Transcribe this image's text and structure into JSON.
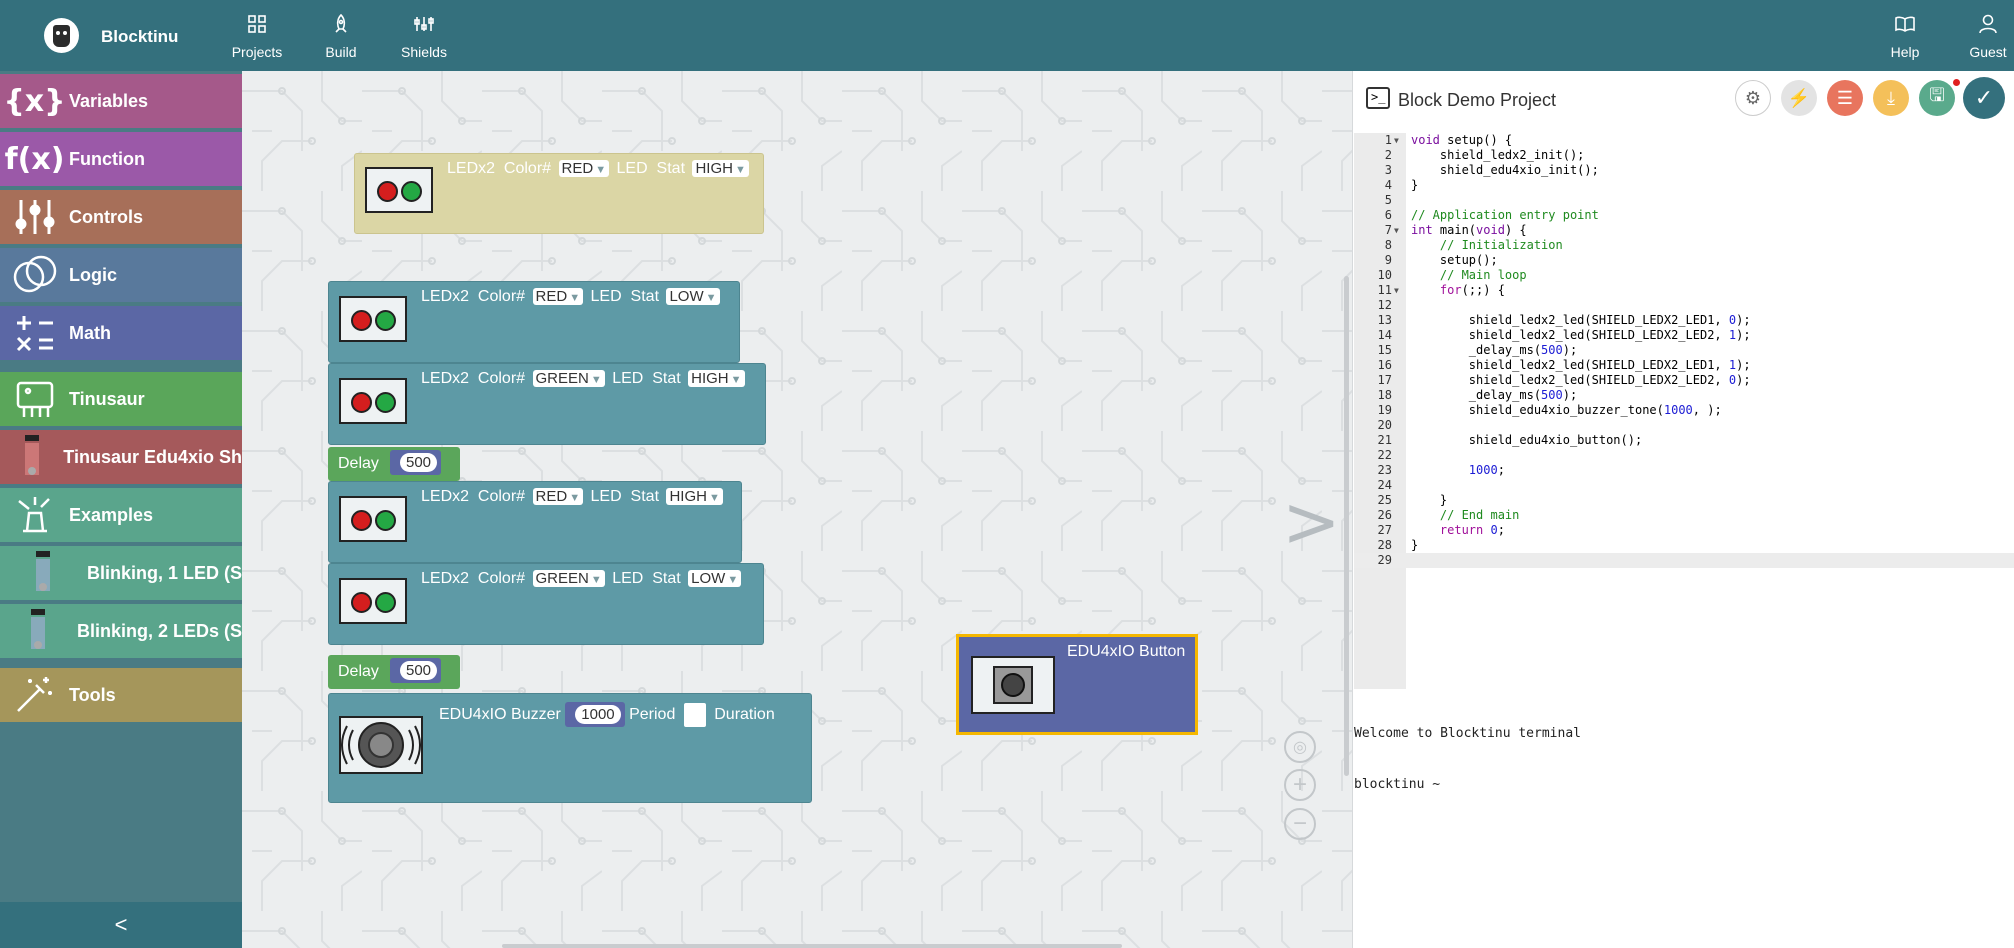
{
  "app": {
    "brand": "Blocktinu"
  },
  "nav": {
    "projects": "Projects",
    "build": "Build",
    "shields": "Shields",
    "help": "Help",
    "guest": "Guest"
  },
  "sidebar": {
    "items": [
      {
        "label": "Variables",
        "color": "#a5598a"
      },
      {
        "label": "Function",
        "color": "#9b59a8"
      },
      {
        "label": "Controls",
        "color": "#a76f59"
      },
      {
        "label": "Logic",
        "color": "#59799c"
      },
      {
        "label": "Math",
        "color": "#5b67a5"
      },
      {
        "label": "Tinusaur",
        "color": "#5aa65a"
      },
      {
        "label": "Tinusaur Edu4xio Sh",
        "color": "#a5595b"
      },
      {
        "label": "Examples",
        "color": "#5aa58c"
      },
      {
        "label": "Blinking, 1 LED (S",
        "color": "#5aa58c"
      },
      {
        "label": "Blinking, 2 LEDs (S",
        "color": "#5aa58c"
      },
      {
        "label": "Tools",
        "color": "#a5965b"
      }
    ],
    "collapse": "<"
  },
  "blocks": {
    "common": {
      "ledx2": "LEDx2",
      "color": "Color#",
      "led": "LED",
      "stat": "Stat",
      "delay": "Delay",
      "buzzer": "EDU4xIO Buzzer",
      "period": "Period",
      "duration": "Duration",
      "button": "EDU4xIO Button"
    },
    "floating_led": {
      "color": "RED",
      "stat": "HIGH"
    },
    "led1": {
      "color": "RED",
      "stat": "LOW"
    },
    "led2": {
      "color": "GREEN",
      "stat": "HIGH"
    },
    "delay1": "500",
    "led3": {
      "color": "RED",
      "stat": "HIGH"
    },
    "led4": {
      "color": "GREEN",
      "stat": "LOW"
    },
    "delay2": "500",
    "buzzer_period": "1000"
  },
  "panel": {
    "title": "Block Demo Project",
    "code": [
      "void setup() {",
      "    shield_ledx2_init();",
      "    shield_edu4xio_init();",
      "}",
      "",
      "// Application entry point",
      "int main(void) {",
      "    // Initialization",
      "    setup();",
      "    // Main loop",
      "    for(;;) {",
      "",
      "        shield_ledx2_led(SHIELD_LEDX2_LED1, 0);",
      "        shield_ledx2_led(SHIELD_LEDX2_LED2, 1);",
      "        _delay_ms(500);",
      "        shield_ledx2_led(SHIELD_LEDX2_LED1, 1);",
      "        shield_ledx2_led(SHIELD_LEDX2_LED2, 0);",
      "        _delay_ms(500);",
      "        shield_edu4xio_buzzer_tone(1000, );",
      "",
      "        shield_edu4xio_button();",
      "",
      "        1000;",
      "",
      "    }",
      "    // End main",
      "    return 0;",
      "}",
      ""
    ],
    "terminal": [
      "Welcome to Blocktinu terminal",
      "blocktinu ~"
    ]
  }
}
